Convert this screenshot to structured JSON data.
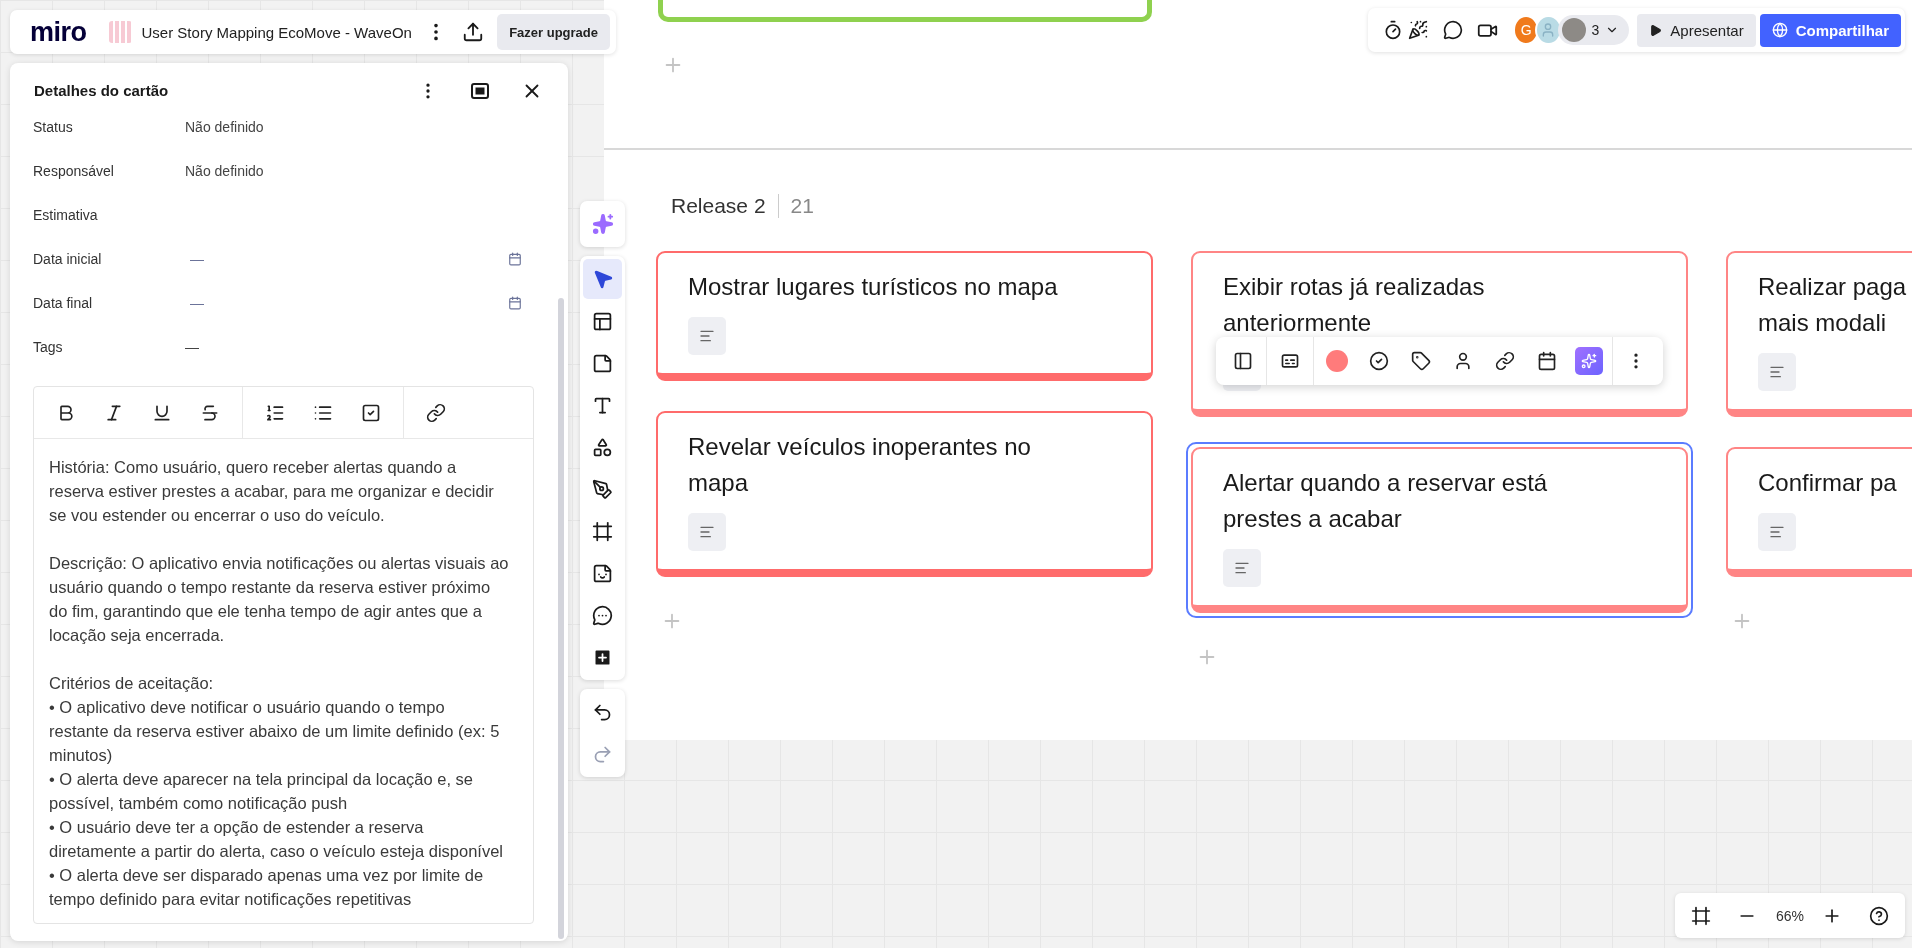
{
  "header": {
    "logo": "miro",
    "board_title": "User Story Mapping EcoMove - WaveOn",
    "upgrade_button": "Fazer upgrade"
  },
  "collaboration": {
    "avatar_initial": "G",
    "collaborator_count": "3",
    "present_button": "Apresentar",
    "share_button": "Compartilhar"
  },
  "card_details": {
    "title": "Detalhes do cartão",
    "fields": [
      {
        "label": "Status",
        "value": "Não definido",
        "kind": "text"
      },
      {
        "label": "Responsável",
        "value": "Não definido",
        "kind": "text"
      },
      {
        "label": "Estimativa",
        "kind": "text"
      },
      {
        "label": "Data inicial",
        "value": "—",
        "kind": "date"
      },
      {
        "label": "Data final",
        "value": "—",
        "kind": "date"
      },
      {
        "label": "Tags",
        "value": "—",
        "kind": "text"
      }
    ],
    "description": [
      "História: Como usuário, quero receber alertas quando a\nreserva estiver prestes a acabar, para me organizar e decidir\nse vou estender ou encerrar o uso do veículo.",
      "Descrição: O aplicativo envia notificações ou alertas visuais ao\nusuário quando o tempo restante da reserva estiver próximo\ndo fim, garantindo que ele tenha tempo de agir antes que a\nlocação seja encerrada.",
      "Critérios de aceitação:\n• O aplicativo deve notificar o usuário quando o tempo\nrestante da reserva estiver abaixo de um limite definido (ex: 5\nminutos)\n• O alerta deve aparecer na tela principal da locação e, se\npossível, também como notificação push\n• O usuário deve ter a opção de estender a reserva\ndiretamente a partir do alerta, caso o veículo esteja disponível\n• O alerta deve ser disparado apenas uma vez por limite de\ntempo definido para evitar notificações repetitivas"
    ]
  },
  "canvas": {
    "release": {
      "title": "Release 2",
      "count": "21"
    },
    "columns": [
      {
        "cards": [
          {
            "title": "Mostrar lugares turísticos no mapa",
            "color": "#ff6b6b",
            "selected": false
          },
          {
            "title": "Revelar veículos inoperantes no\nmapa",
            "color": "#ff6b6b",
            "selected": false
          }
        ]
      },
      {
        "cards": [
          {
            "title": "Exibir rotas já realizadas\nanteriormente",
            "color": "#ff8585",
            "selected": false
          },
          {
            "title": "Alertar quando a reservar está\nprestes a acabar",
            "color": "#ff8585",
            "selected": true
          }
        ]
      },
      {
        "cards": [
          {
            "title": "Realizar paga\nmais modali",
            "color": "#ff8585",
            "selected": false
          },
          {
            "title": "Confirmar pa",
            "color": "#ff8585",
            "selected": false
          }
        ]
      }
    ]
  },
  "zoom": {
    "level_text": "66%"
  }
}
